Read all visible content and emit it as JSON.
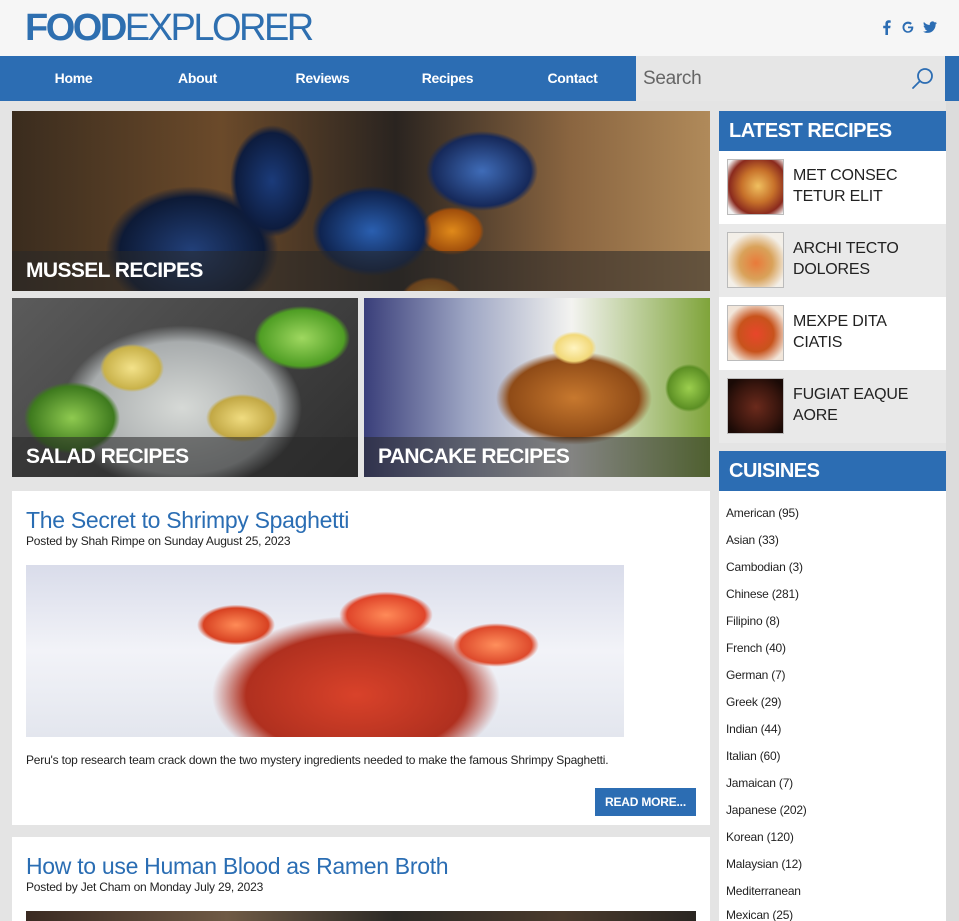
{
  "header": {
    "logo_bold": "FOOD",
    "logo_light": "EXPLORER",
    "social": [
      "facebook-icon",
      "google-icon",
      "twitter-icon"
    ]
  },
  "nav": {
    "items": [
      "Home",
      "About",
      "Reviews",
      "Recipes",
      "Contact"
    ],
    "search_placeholder": "Search"
  },
  "hero": {
    "tiles": [
      {
        "caption": "MUSSEL RECIPES"
      },
      {
        "caption": "SALAD RECIPES"
      },
      {
        "caption": "PANCAKE RECIPES"
      }
    ]
  },
  "posts": [
    {
      "title": "The Secret to Shrimpy Spaghetti",
      "meta": "Posted by Shah Rimpe on Sunday August 25, 2023",
      "excerpt": "Peru's top research team crack down the two mystery ingredients needed to make the famous Shrimpy Spaghetti.",
      "read_more": "READ MORE..."
    },
    {
      "title": "How to use Human Blood as Ramen Broth",
      "meta": "Posted by Jet Cham on Monday July 29, 2023"
    }
  ],
  "sidebar": {
    "latest_title": "LATEST RECIPES",
    "latest": [
      {
        "line1": "MET CONSEC",
        "line2": "TETUR ELIT"
      },
      {
        "line1": "ARCHI TECTO",
        "line2": "DOLORES"
      },
      {
        "line1": "MEXPE DITA",
        "line2": "CIATIS"
      },
      {
        "line1": "FUGIAT EAQUE",
        "line2": "AORE"
      }
    ],
    "cuisines_title": "CUISINES",
    "cuisines": [
      "American (95)",
      "Asian (33)",
      "Cambodian (3)",
      "Chinese (281)",
      "Filipino (8)",
      "French (40)",
      "German (7)",
      "Greek (29)",
      "Indian (44)",
      "Italian (60)",
      "Jamaican (7)",
      "Japanese (202)",
      "Korean (120)",
      "Malaysian (12)",
      "Mediterranean",
      "Mexican (25)"
    ]
  },
  "colors": {
    "brand": "#2c6db3",
    "background": "#e4e4e4"
  }
}
